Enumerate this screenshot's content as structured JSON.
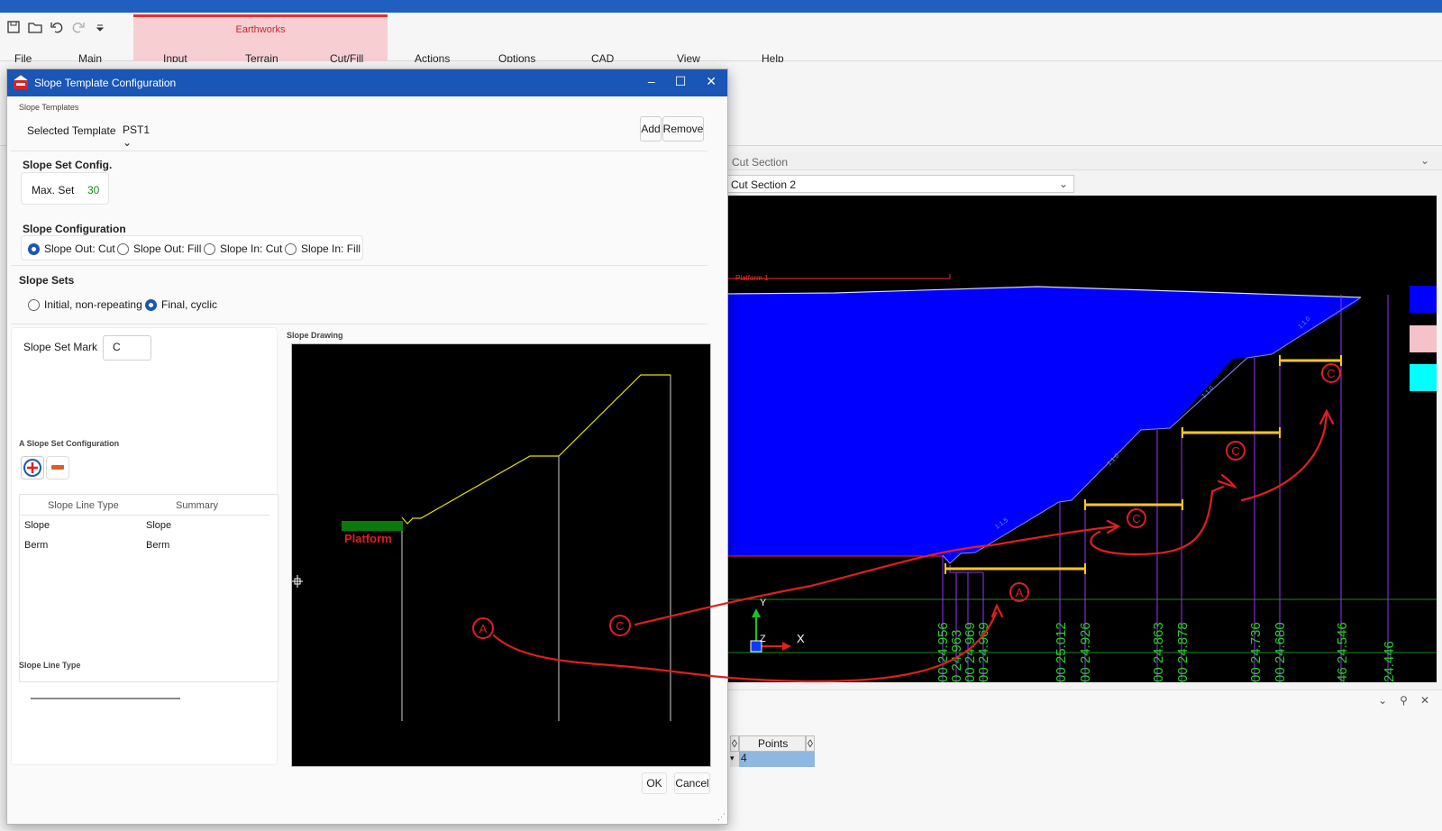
{
  "ribbon": {
    "context_group": "Earthworks",
    "tabs": [
      "File",
      "Main",
      "Input",
      "Terrain",
      "Cut/Fill",
      "Actions",
      "Options",
      "CAD",
      "View",
      "Help"
    ],
    "active_tab": "Options"
  },
  "document": {
    "panel_title": "Cut Section",
    "section_select": "Cut Section 2",
    "canvas": {
      "platform_label": "Platform 1",
      "slope_labels": [
        "1:1.5",
        "1:1.0",
        "1:1.0",
        "1:1.0",
        "1:1.0"
      ],
      "station_labels": [
        "00 24.956",
        "0 24.963",
        "00 24.969",
        "00 24.969",
        "00 25.012",
        "00 24.926",
        "00 24.863",
        "00 24.878",
        "00 24.736",
        "00 24.680",
        "46 24.546",
        "24.446"
      ],
      "axis_y": "Y",
      "axis_z": "Z",
      "axis_x": "X",
      "annotations": [
        "A",
        "C",
        "C",
        "C",
        "C",
        "A",
        "C"
      ]
    },
    "legend_colors": [
      "#0000ff",
      "#000000",
      "#f4c2c8",
      "#000000",
      "#00ffff"
    ]
  },
  "lower_panel": {
    "grid_header": [
      "Points"
    ],
    "grid_row_value": "4"
  },
  "dialog": {
    "title": "Slope Template Configuration",
    "slope_templates": {
      "group_label": "Slope Templates",
      "selected_label": "Selected Template",
      "selected_value": "PST1",
      "add": "Add",
      "remove": "Remove"
    },
    "slope_set_config": {
      "label": "Slope Set Config.",
      "max_set_label": "Max. Set",
      "max_set_value": "30"
    },
    "slope_configuration": {
      "label": "Slope Configuration",
      "options": [
        "Slope Out: Cut",
        "Slope Out: Fill",
        "Slope In: Cut",
        "Slope In: Fill"
      ],
      "selected": 0
    },
    "slope_sets": {
      "label": "Slope Sets",
      "options": [
        "Initial, non-repeating",
        "Final, cyclic"
      ],
      "selected": 1
    },
    "mark": {
      "label": "Slope Set Mark",
      "value": "C"
    },
    "set_config": {
      "label": "A Slope Set Configuration",
      "columns": [
        "Slope Line Type",
        "Summary"
      ],
      "rows": [
        [
          "Slope",
          "Slope"
        ],
        [
          "Berm",
          "Berm"
        ]
      ]
    },
    "line_type_label": "Slope Line Type",
    "drawing": {
      "label": "Slope Drawing",
      "platform_label": "Platform"
    },
    "ok": "OK",
    "cancel": "Cancel"
  }
}
